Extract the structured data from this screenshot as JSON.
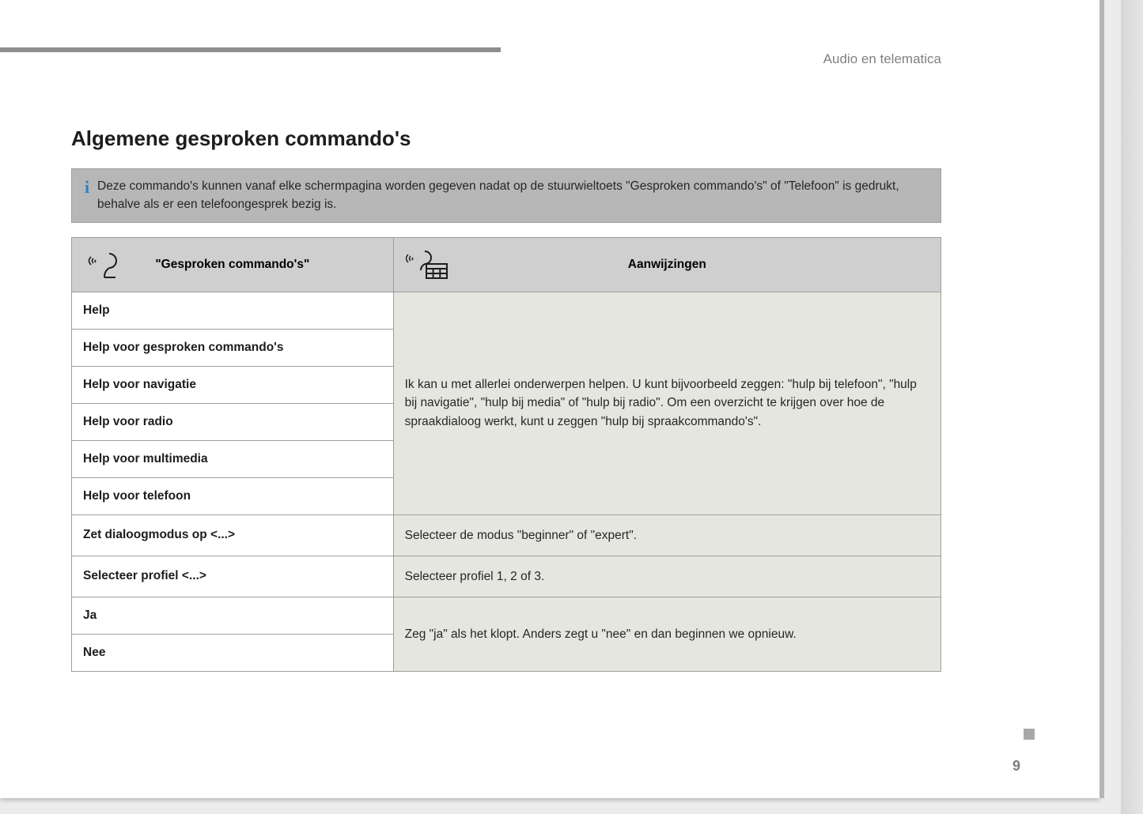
{
  "header": {
    "section": "Audio en telematica",
    "title": "Algemene gesproken commando's"
  },
  "info": {
    "icon_label": "i",
    "text": "Deze commando's kunnen vanaf elke schermpagina worden gegeven nadat op de stuurwieltoets \"Gesproken commando's\" of \"Telefoon\" is gedrukt, behalve als er een telefoongesprek bezig is."
  },
  "table": {
    "columns": {
      "commands": "\"Gesproken commando's\"",
      "instructions": "Aanwijzingen"
    },
    "groups": [
      {
        "commands": [
          "Help",
          "Help voor gesproken commando's",
          "Help voor navigatie",
          "Help voor radio",
          "Help voor multimedia",
          "Help voor telefoon"
        ],
        "instruction": "Ik kan u met allerlei onderwerpen helpen. U kunt bijvoorbeeld zeggen: \"hulp bij telefoon\", \"hulp bij navigatie\", \"hulp bij media\" of \"hulp bij radio\". Om een overzicht te krijgen over hoe de spraakdialoog werkt, kunt u zeggen \"hulp bij spraakcommando's\"."
      },
      {
        "commands": [
          "Zet dialoogmodus op <...>"
        ],
        "instruction": "Selecteer de modus \"beginner\" of \"expert\"."
      },
      {
        "commands": [
          "Selecteer profiel <...>"
        ],
        "instruction": "Selecteer profiel 1, 2 of 3."
      },
      {
        "commands": [
          "Ja",
          "Nee"
        ],
        "instruction": "Zeg \"ja\" als het klopt. Anders zegt u \"nee\" en dan beginnen we opnieuw."
      }
    ]
  },
  "page_number": "9"
}
